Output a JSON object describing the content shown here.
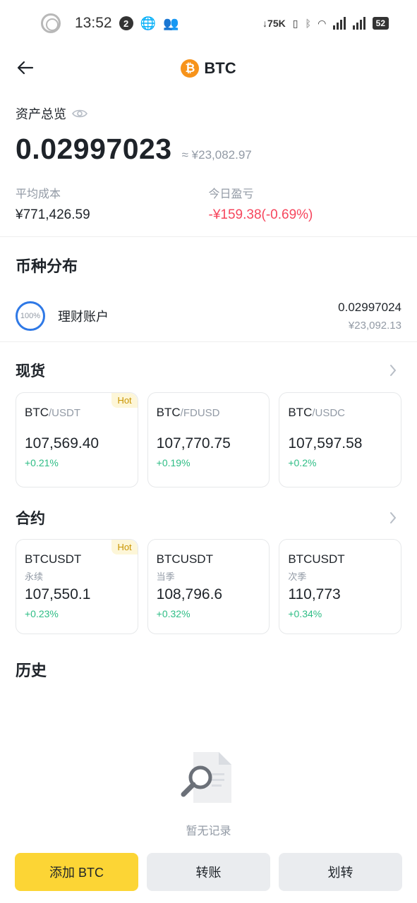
{
  "status_bar": {
    "time": "13:52",
    "notification_count": "2",
    "network_speed": "75K",
    "battery": "52"
  },
  "header": {
    "title": "BTC",
    "logo_glyph": "₿",
    "back_icon": "arrow-left-icon"
  },
  "overview": {
    "label": "资产总览",
    "eye_icon": "eye-icon",
    "amount": "0.02997023",
    "approx_value": "≈ ¥23,082.97",
    "avg_cost_label": "平均成本",
    "avg_cost_value": "¥771,426.59",
    "today_pnl_label": "今日盈亏",
    "today_pnl_value": "-¥159.38(-0.69%)"
  },
  "distribution": {
    "title": "币种分布",
    "items": [
      {
        "percent": "100%",
        "name": "理财账户",
        "amount": "0.02997024",
        "fiat": "¥23,092.13"
      }
    ]
  },
  "spot": {
    "title": "现货",
    "cards": [
      {
        "base": "BTC",
        "quote": "/USDT",
        "price": "107,569.40",
        "change": "+0.21%",
        "badge": "Hot"
      },
      {
        "base": "BTC",
        "quote": "/FDUSD",
        "price": "107,770.75",
        "change": "+0.19%",
        "badge": ""
      },
      {
        "base": "BTC",
        "quote": "/USDC",
        "price": "107,597.58",
        "change": "+0.2%",
        "badge": ""
      }
    ]
  },
  "futures": {
    "title": "合约",
    "cards": [
      {
        "symbol": "BTCUSDT",
        "type": "永续",
        "price": "107,550.1",
        "change": "+0.23%",
        "badge": "Hot"
      },
      {
        "symbol": "BTCUSDT",
        "type": "当季",
        "price": "108,796.6",
        "change": "+0.32%",
        "badge": ""
      },
      {
        "symbol": "BTCUSDT",
        "type": "次季",
        "price": "110,773",
        "change": "+0.34%",
        "badge": ""
      }
    ]
  },
  "history": {
    "title": "历史",
    "empty_text": "暂无记录"
  },
  "actions": {
    "add_label": "添加 BTC",
    "transfer_label": "转账",
    "move_label": "划转"
  },
  "colors": {
    "brand_yellow": "#fcd535",
    "negative": "#f6465d",
    "positive": "#2ebd85",
    "btc_orange": "#f7931a",
    "ring_blue": "#2f79e6"
  }
}
